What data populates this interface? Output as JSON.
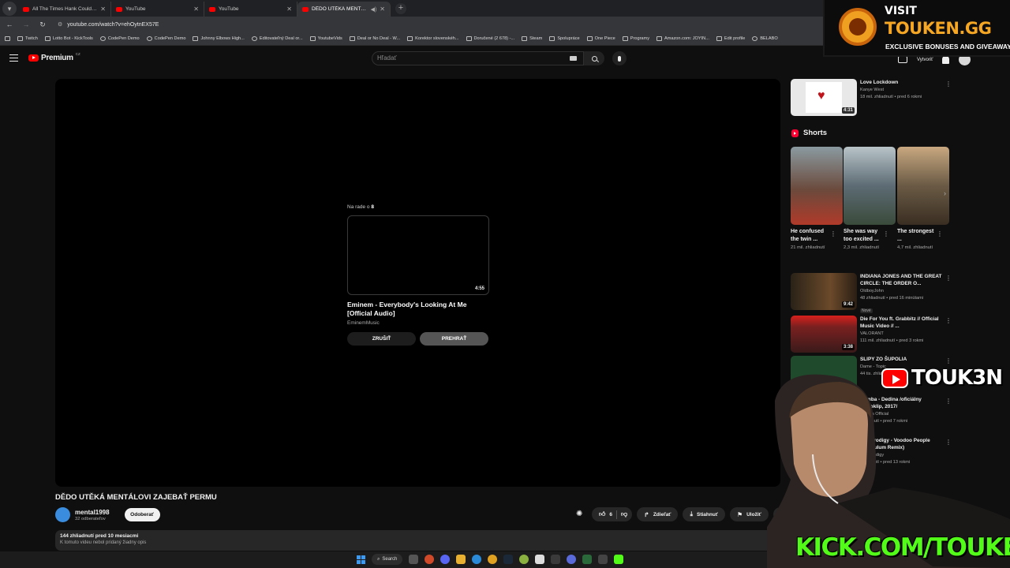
{
  "browser": {
    "tabs": [
      {
        "title": "All The Times Hank Could've Cr",
        "active": false
      },
      {
        "title": "YouTube",
        "active": false
      },
      {
        "title": "YouTube",
        "active": false
      },
      {
        "title": "DĚDO UTĚKÁ MENTÁLOVI",
        "active": true
      }
    ],
    "url": "youtube.com/watch?v=ehOytnEX57E",
    "bookmarks": [
      "Twitch",
      "Lotto Bot - KickTools",
      "CodePen Demo",
      "CodePen Demo",
      "Johnny Elbows High...",
      "Editovateľný Deal or...",
      "YoutubeVids",
      "Deal or No Deal - W...",
      "Korektor slovenskéh...",
      "Doručené (2 678) -...",
      "Steam",
      "Spolupráce",
      "One Piece",
      "Programy",
      "Amazon.com: JOYIN...",
      "Edit profile",
      "BELABO"
    ]
  },
  "header": {
    "brand": "Premium",
    "region": "CZ",
    "search_placeholder": "Hľadať",
    "create_label": "Vytvoriť"
  },
  "player": {
    "upnext_label": "Na rade o",
    "upnext_countdown": "8",
    "upnext_duration": "4:55",
    "upnext_title": "Eminem - Everybody's Looking At Me [Official Audio]",
    "upnext_channel": "EminemMusic",
    "cancel_label": "ZRUŠIŤ",
    "play_label": "PREHRAŤ"
  },
  "video": {
    "title": "DĚDO UTĚKÁ MENTÁLOVI ZAJEBAŤ PERMU",
    "channel": "mental1998",
    "subscribers": "32 odberateľov",
    "subscribe_label": "Odoberať",
    "likes": "6",
    "share_label": "Zdieľať",
    "download_label": "Stiahnuť",
    "save_label": "Uložiť",
    "stats": "144 zhliadnutí  pred 10 mesiacmi",
    "description": "K tomuto videu nebol pridaný žiadny opis"
  },
  "sidebar": {
    "top_item": {
      "title": "Love Lockdown",
      "channel": "Kanye West",
      "meta": "18 mil. zhliadnutí • pred 6 rokmi",
      "duration": "4:31"
    },
    "shorts_label": "Shorts",
    "shorts": [
      {
        "title": "He confused the twin ...",
        "views": "21 mil. zhliadnutí",
        "thumb_color": "#6b4a3c"
      },
      {
        "title": "She was way too excited ...",
        "views": "2,3 mil. zhliadnutí",
        "thumb_color": "#5d6b74"
      },
      {
        "title": "The strongest ...",
        "views": "4,7 mil. zhliadnutí",
        "thumb_color": "#6a5a45"
      }
    ],
    "items": [
      {
        "title": "INDIANA JONES AND THE GREAT CIRCLE: THE ORDER O...",
        "channel": "OldboyJohn",
        "meta": "48 zhliadnutí • pred 16 minútami",
        "badge": "Nové",
        "duration": "9:42",
        "thumb_color": "#4a3a2a"
      },
      {
        "title": "Die For You ft. Grabbitz // Official Music Video // ...",
        "channel": "VALORANT",
        "meta": "111 mil. zhliadnutí • pred 3 rokmi",
        "duration": "3:38",
        "thumb_color": "#7a2020"
      },
      {
        "title": "SLIPY ZO ŠUPOLIA",
        "channel": "Dame - Topic",
        "meta": "44 tis. zhliadnutí",
        "duration": "",
        "thumb_color": "#1f4a2c"
      },
      {
        "title": "Kamba - Dedina /oficiálny videoklip, 2017/",
        "channel": "Kamba Official",
        "meta": "zhliadnutí • pred 7 rokmi",
        "duration": "",
        "thumb_color": "#2a2a2a"
      },
      {
        "title": "The Prodigy - Voodoo People (Pendulum Remix)",
        "channel": "The Prodigy",
        "meta": "zhliadnutí • pred 13 rokmi",
        "duration": "",
        "thumb_color": "#2a2a2a"
      }
    ]
  },
  "overlay": {
    "visit": "VISIT",
    "brand": "TOUKEN.GG",
    "tagline": "EXCLUSIVE BONUSES AND GIVEAWAYS",
    "yt_handle": "TOUK3N",
    "kick": "KICK.COM/TOUKEN"
  },
  "taskbar": {
    "search_label": "Search"
  },
  "colors": {
    "yt_red": "#ff0000",
    "kick_green": "#53fc18",
    "promo_orange": "#f5a623"
  }
}
